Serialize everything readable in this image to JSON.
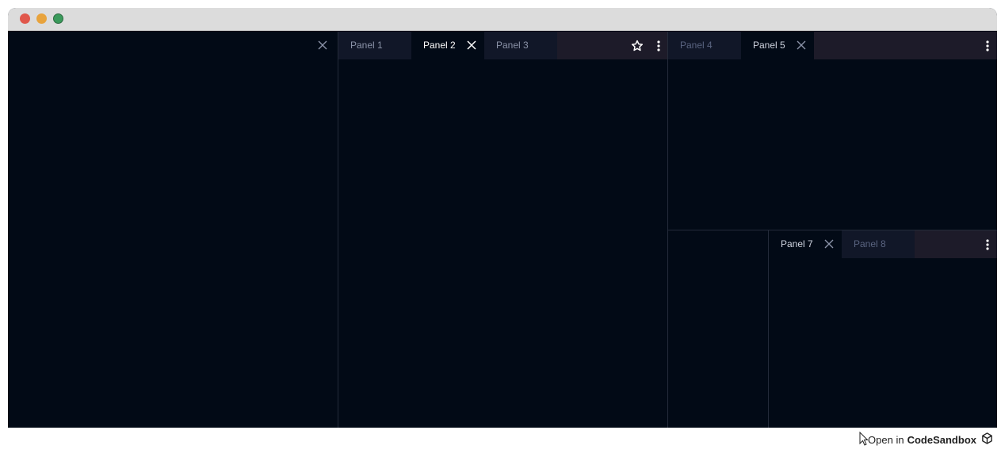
{
  "window": {
    "traffic_lights": [
      "close",
      "minimize",
      "zoom"
    ]
  },
  "groups": {
    "left": {
      "tabs": []
    },
    "middle": {
      "tabs": [
        {
          "label": "Panel 1",
          "state": "inactive"
        },
        {
          "label": "Panel 2",
          "state": "active"
        },
        {
          "label": "Panel 3",
          "state": "inactive"
        }
      ],
      "actions": [
        "star-icon",
        "more-vertical-icon"
      ]
    },
    "right_top": {
      "tabs": [
        {
          "label": "Panel 4",
          "state": "inactive"
        },
        {
          "label": "Panel 5",
          "state": "active"
        }
      ],
      "actions": [
        "more-vertical-icon"
      ]
    },
    "right_bottom_left": {
      "tabs": []
    },
    "right_bottom_right": {
      "tabs": [
        {
          "label": "Panel 7",
          "state": "active"
        },
        {
          "label": "Panel 8",
          "state": "inactive"
        }
      ],
      "actions": [
        "more-vertical-icon"
      ]
    }
  },
  "footer": {
    "prefix": "Open in",
    "brand": "CodeSandbox"
  },
  "colors": {
    "background": "#020a16",
    "tabbar": "#1d1b29",
    "inactive_tab": "#111728",
    "separator": "#242b3a",
    "titlebar": "#dcdcdc"
  }
}
